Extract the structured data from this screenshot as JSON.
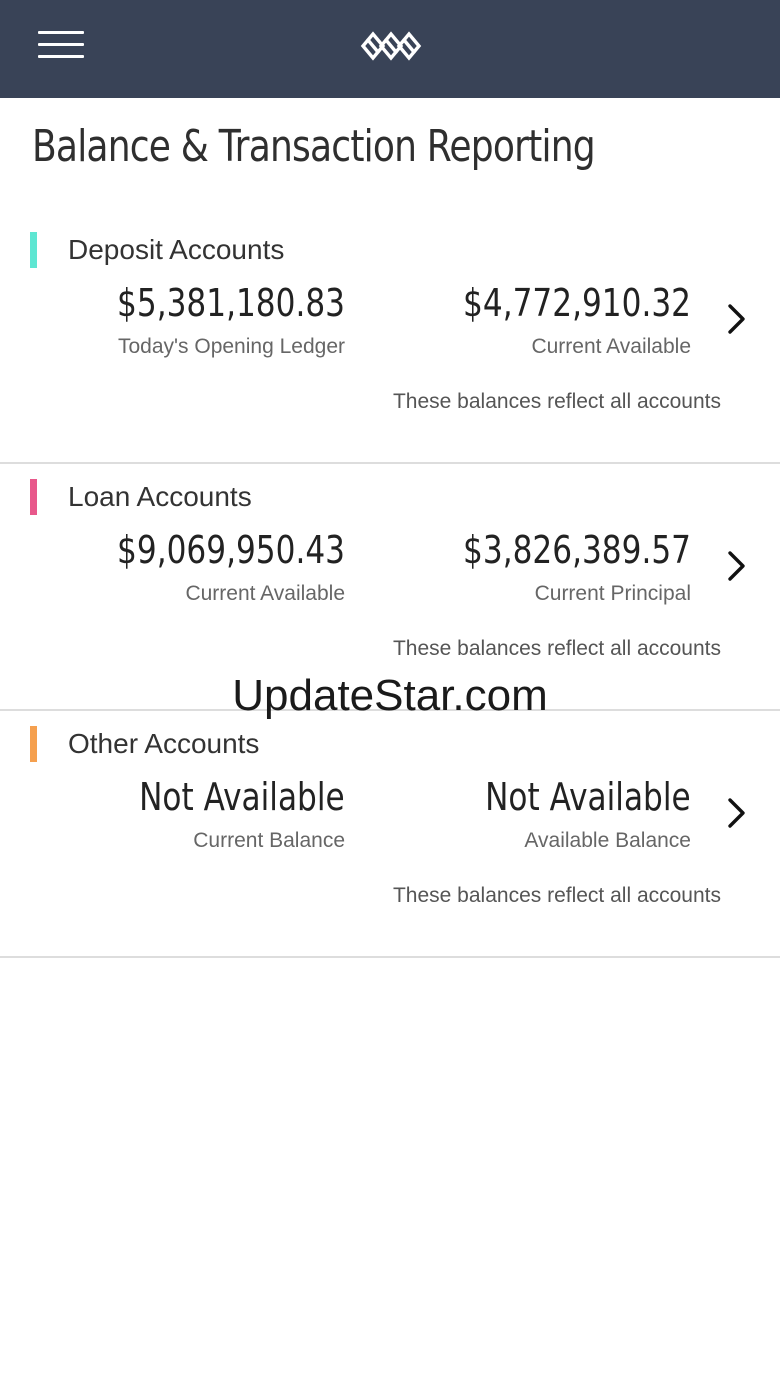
{
  "header": {
    "menu_icon": "hamburger-menu-icon",
    "logo_icon": "interlocking-rings-logo"
  },
  "page": {
    "title": "Balance & Transaction Reporting"
  },
  "sections": [
    {
      "title": "Deposit Accounts",
      "accent_color": "#5ee6d2",
      "left_amount": "$5,381,180.83",
      "left_caption": "Today's Opening Ledger",
      "right_amount": "$4,772,910.32",
      "right_caption": "Current Available",
      "note": "These balances reflect all accounts"
    },
    {
      "title": "Loan Accounts",
      "accent_color": "#e8588b",
      "left_amount": "$9,069,950.43",
      "left_caption": "Current Available",
      "right_amount": "$3,826,389.57",
      "right_caption": "Current Principal",
      "note": "These balances reflect all accounts"
    },
    {
      "title": "Other Accounts",
      "accent_color": "#f5a04f",
      "left_amount": "Not Available",
      "left_caption": "Current Balance",
      "right_amount": "Not Available",
      "right_caption": "Available Balance",
      "note": "These balances reflect all accounts"
    }
  ],
  "watermark": "UpdateStar.com",
  "colors": {
    "header_bg": "#394357",
    "divider": "#dddddd"
  }
}
